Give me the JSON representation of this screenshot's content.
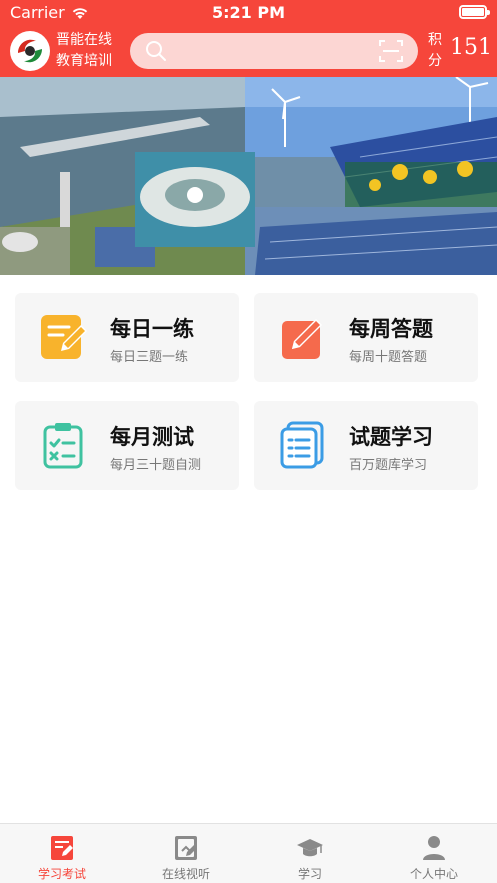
{
  "status_bar": {
    "carrier": "Carrier",
    "time": "5:21 PM"
  },
  "header": {
    "brand_line1": "晋能在线",
    "brand_line2": "教育培训",
    "search_placeholder": "",
    "points_label_1": "积",
    "points_label_2": "分",
    "points_value": "151",
    "accent_color": "#f6463b"
  },
  "cards": [
    {
      "title": "每日一练",
      "subtitle": "每日三题一练",
      "icon": "edit-note-icon",
      "color": "#f8b32c"
    },
    {
      "title": "每周答题",
      "subtitle": "每周十题答题",
      "icon": "pencil-box-icon",
      "color": "#f56a4c"
    },
    {
      "title": "每月测试",
      "subtitle": "每月三十题自测",
      "icon": "clipboard-check-icon",
      "color": "#3fc2a0"
    },
    {
      "title": "试题学习",
      "subtitle": "百万题库学习",
      "icon": "document-stack-icon",
      "color": "#3b9ce5"
    }
  ],
  "tabbar": [
    {
      "label": "学习考试",
      "icon": "exam-icon",
      "active": true
    },
    {
      "label": "在线视听",
      "icon": "video-icon",
      "active": false
    },
    {
      "label": "学习",
      "icon": "graduation-cap-icon",
      "active": false
    },
    {
      "label": "个人中心",
      "icon": "person-icon",
      "active": false
    }
  ]
}
